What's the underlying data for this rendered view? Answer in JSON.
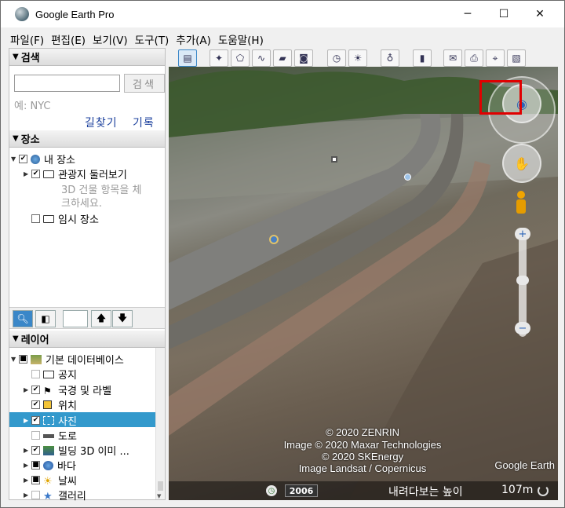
{
  "window": {
    "title": "Google Earth Pro",
    "minimize_glyph": "─",
    "maximize_glyph": "☐",
    "close_glyph": "✕"
  },
  "menu": [
    "파일(F)",
    "편집(E)",
    "보기(V)",
    "도구(T)",
    "추가(A)",
    "도움말(H)"
  ],
  "search": {
    "header": "검색",
    "button": "검색",
    "placeholder": "",
    "hint": "예: NYC",
    "links": {
      "directions": "길찾기",
      "history": "기록"
    }
  },
  "places": {
    "header": "장소",
    "my_places": "내 장소",
    "tour": "관광지 둘러보기",
    "tour_hint_1": "3D 건물 항목을 체",
    "tour_hint_2": "크하세요.",
    "temp": "임시 장소"
  },
  "layers": {
    "header": "레이어",
    "items": [
      {
        "label": "기본 데이터베이스",
        "checked": "■",
        "icon": "layers-icon"
      },
      {
        "label": "공지",
        "checked": "",
        "icon": "mail-icon"
      },
      {
        "label": "국경 및 라벨",
        "checked": "✔",
        "icon": "flag-icon"
      },
      {
        "label": "위치",
        "checked": "✔",
        "icon": "place-icon"
      },
      {
        "label": "사진",
        "checked": "✔",
        "icon": "photo-icon",
        "selected": true
      },
      {
        "label": "도로",
        "checked": "",
        "icon": "road-icon"
      },
      {
        "label": "빌딩 3D 이미 ...",
        "checked": "✔",
        "icon": "building-icon"
      },
      {
        "label": "바다",
        "checked": "■",
        "icon": "ocean-icon"
      },
      {
        "label": "날씨",
        "checked": "■",
        "icon": "weather-icon"
      },
      {
        "label": "갤러리",
        "checked": "",
        "icon": "gallery-icon"
      }
    ]
  },
  "map": {
    "credits": [
      "© 2020 ZENRIN",
      "Image © 2020 Maxar Technologies",
      "© 2020 SKEnergy",
      "Image Landsat / Copernicus"
    ],
    "brand": "Google Earth",
    "year": "2006",
    "eye_alt_label": "내려다보는 높이",
    "eye_alt_value": "107m"
  },
  "colors": {
    "highlight": "#3399cc",
    "link": "#1a3f9c",
    "annotation": "#e00000"
  }
}
